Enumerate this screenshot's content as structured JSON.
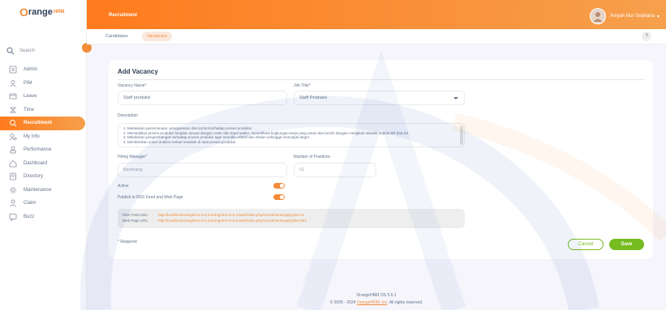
{
  "brand": {
    "logo_o": "O",
    "logo_text": "range",
    "logo_hrm": "HRM"
  },
  "sidebar": {
    "search_label": "Search",
    "items": [
      {
        "label": "Admin",
        "icon": "admin-icon"
      },
      {
        "label": "PIM",
        "icon": "pim-icon"
      },
      {
        "label": "Leave",
        "icon": "leave-icon"
      },
      {
        "label": "Time",
        "icon": "time-icon"
      },
      {
        "label": "Recruitment",
        "icon": "recruitment-icon",
        "active": true
      },
      {
        "label": "My Info",
        "icon": "myinfo-icon"
      },
      {
        "label": "Performance",
        "icon": "performance-icon"
      },
      {
        "label": "Dashboard",
        "icon": "dashboard-icon"
      },
      {
        "label": "Directory",
        "icon": "directory-icon"
      },
      {
        "label": "Maintenance",
        "icon": "maintenance-icon"
      },
      {
        "label": "Claim",
        "icon": "claim-icon"
      },
      {
        "label": "Buzz",
        "icon": "buzz-icon"
      }
    ]
  },
  "header": {
    "title": "Recruitment",
    "user_name": "Aniyah Nur Septiana",
    "help": "?"
  },
  "tabs": [
    {
      "label": "Candidates"
    },
    {
      "label": "Vacancies"
    }
  ],
  "form": {
    "title": "Add Vacancy",
    "vacancy_name_label": "Vacancy Name*",
    "vacancy_name_value": "Staff produksi",
    "job_title_label": "Job Title*",
    "job_title_value": "Staff Produksi",
    "description_label": "Description",
    "description_lines": [
      "1. Melakukan perencanaan, pengawasan dan kontrol terhadap proses produksi",
      "2. Memastikan proses produksi berjalan sesuai dengan order dan tepat waktu, memelihara lingkungan kerja yang aman dan bersih dengan mengikuti standar seperti 5R dan K3",
      "3. Melakukan pengembangan terhadap proses produksi agar semakin efektif dan efisien sehingga mencapai target",
      "4. Memberikan solusi analisis terkait masalah di saat proses produksi"
    ],
    "hiring_manager_label": "Hiring Manager*",
    "hiring_manager_value": "Bambang",
    "positions_label": "Number of Positions",
    "positions_value": "01",
    "active_label": "Active",
    "active_on": true,
    "publish_label": "Publish in RSS Feed and Web Page",
    "publish_on": true,
    "rss_label": "RSS Feed URL:",
    "rss_url": "http://localhost/orangehrm-5.6.1/orangehrm-5.6.1/web/index.php/recruitmentApply/jobs.rss",
    "web_label": "Web Page URL:",
    "web_url": "http://localhost/orangehrm-5.6.1/orangehrm-5.6.1/web/index.php/recruitmentApply/jobs.html",
    "required_note": "* Required",
    "cancel_label": "Cancel",
    "save_label": "Save"
  },
  "footer": {
    "version": "OrangeHRM OS 5.6.1",
    "copyright_prefix": "© 2005 - 2024",
    "copyright_link": "OrangeHRM, Inc",
    "copyright_suffix": ". All rights reserved."
  },
  "colors": {
    "accent": "#f28c38",
    "save": "#76bc21",
    "bg": "#f6f5fb"
  }
}
